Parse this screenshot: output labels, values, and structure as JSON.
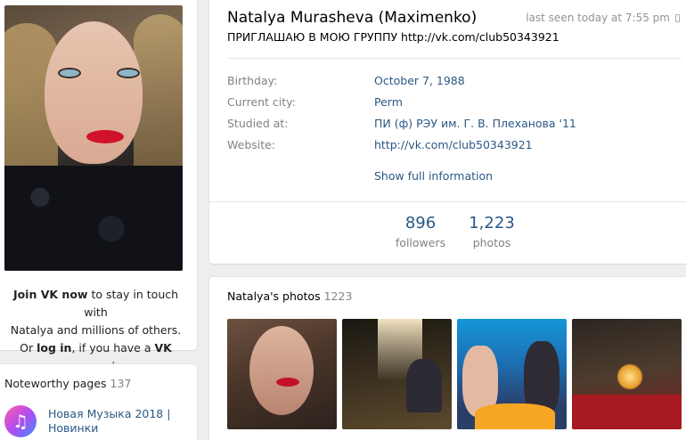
{
  "sidebar": {
    "join": {
      "line1_bold": "Join VK now",
      "line1_rest": " to stay in touch with",
      "line2": "Natalya and millions of others.",
      "line3_pre": "Or ",
      "line3_link": "log in",
      "line3_mid": ", if you have a ",
      "line3_bold": "VK",
      "line3_end": " account."
    },
    "noteworthy": {
      "title": "Noteworthy pages",
      "count": "137",
      "items": [
        {
          "label": "Новая Музыка 2018 | Новинки",
          "icon": "music-note-icon"
        }
      ]
    }
  },
  "profile": {
    "name": "Natalya Murasheva (Maximenko)",
    "last_seen": "last seen today at 7:55 pm",
    "status": "ПРИГЛАШАЮ В МОЮ ГРУППУ http://vk.com/club50343921",
    "info": [
      {
        "label": "Birthday:",
        "value": "October 7, 1988"
      },
      {
        "label": "Current city:",
        "value": "Perm"
      },
      {
        "label": "Studied at:",
        "value": "ПИ (ф) РЭУ им. Г. В. Плеханова '11"
      },
      {
        "label": "Website:",
        "value": "http://vk.com/club50343921"
      }
    ],
    "show_full": "Show full information",
    "counters": {
      "followers": {
        "value": "896",
        "label": "followers"
      },
      "photos": {
        "value": "1,223",
        "label": "photos"
      }
    }
  },
  "photos_section": {
    "title": "Natalya's photos",
    "count": "1223"
  },
  "colors": {
    "link": "#2a5885",
    "muted": "#828282",
    "background": "#edeef0"
  }
}
